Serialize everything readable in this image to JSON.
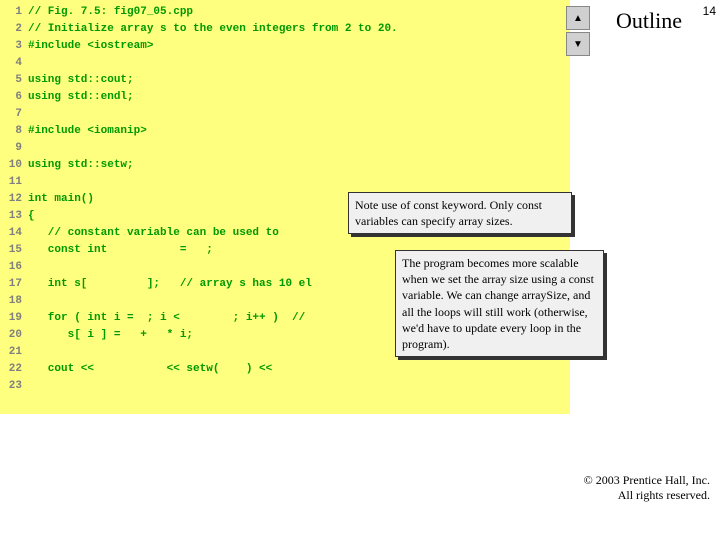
{
  "header": {
    "outline_label": "Outline",
    "page_number": "14",
    "nav_up": "▲",
    "nav_down": "▼"
  },
  "code": {
    "lines": [
      "// Fig. 7.5: fig07_05.cpp",
      "// Initialize array s to the even integers from 2 to 20.",
      "#include <iostream>",
      "",
      "using std::cout;",
      "using std::endl;",
      "",
      "#include <iomanip>",
      "",
      "using std::setw;",
      "",
      "int main()",
      "{",
      "   // constant variable can be used to",
      "   const int           =   ;",
      "",
      "   int s[         ];   // array s has 10 el",
      "",
      "   for ( int i =  ; i <        ; i++ )  //",
      "      s[ i ] =   +   * i;",
      "",
      "   cout <<           << setw(    ) <<",
      ""
    ]
  },
  "callouts": {
    "c1": "Note use of const keyword. Only const variables can specify array sizes.",
    "c2": "The program becomes more scalable when we set the array size using a const variable. We can change arraySize, and all the loops will still work (otherwise, we'd have to update every loop in the program)."
  },
  "footer": {
    "line1": "© 2003 Prentice Hall, Inc.",
    "line2": "All rights reserved."
  }
}
